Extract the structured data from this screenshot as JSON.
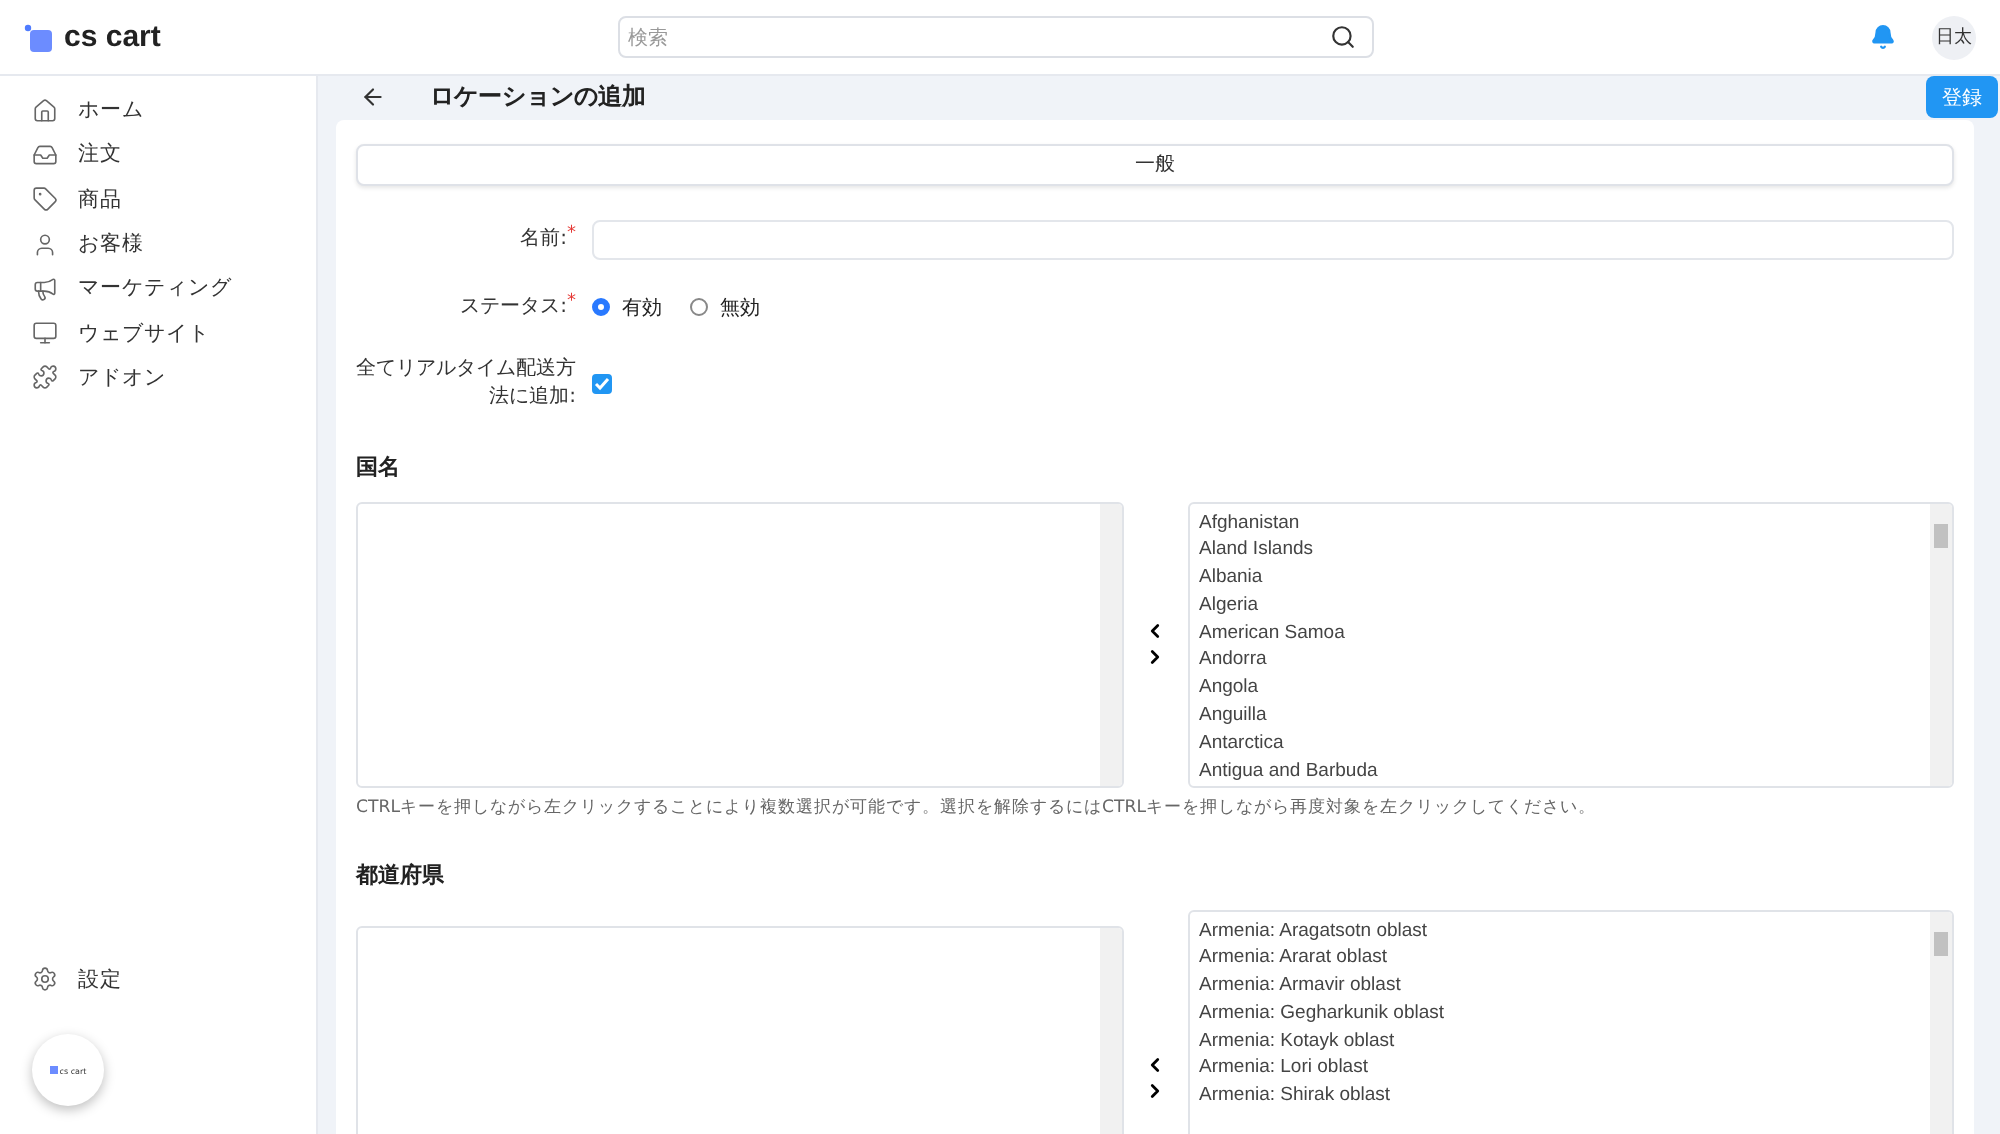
{
  "header": {
    "logo": "cs cart",
    "search": {
      "placeholder": "検索"
    },
    "user_badge": "日太"
  },
  "sidebar": {
    "items": [
      {
        "label": "ホーム"
      },
      {
        "label": "注文"
      },
      {
        "label": "商品"
      },
      {
        "label": "お客様"
      },
      {
        "label": "マーケティング"
      },
      {
        "label": "ウェブサイト"
      },
      {
        "label": "アドオン"
      }
    ],
    "settings": "設定",
    "floating_logo": "cs cart"
  },
  "page": {
    "title": "ロケーションの追加",
    "save_button": "登録"
  },
  "tabs": [
    {
      "label": "一般",
      "selected": true
    }
  ],
  "form": {
    "name_label": "名前:",
    "name_required": "*",
    "status_label": "ステータス:",
    "status_required": "*",
    "status_options": [
      {
        "label": "有効",
        "selected": true
      },
      {
        "label": "無効",
        "selected": false
      }
    ],
    "realtime_label": "全てリアルタイム配送方法に追加:",
    "realtime_checked": true
  },
  "sections": [
    {
      "title": "国名",
      "available_items": [
        "Afghanistan",
        "Aland Islands",
        "Albania",
        "Algeria",
        "American Samoa",
        "Andorra",
        "Angola",
        "Anguilla",
        "Antarctica",
        "Antigua and Barbuda"
      ],
      "hint": "CTRLキーを押しながら左クリックすることにより複数選択が可能です。選択を解除するにはCTRLキーを押しながら再度対象を左クリックしてください。"
    },
    {
      "title": "都道府県",
      "available_items": [
        "Armenia: Aragatsotn oblast",
        "Armenia: Ararat oblast",
        "Armenia: Armavir oblast",
        "Armenia: Gegharkunik oblast",
        "Armenia: Kotayk oblast",
        "Armenia: Lori oblast",
        "Armenia: Shirak oblast"
      ]
    }
  ]
}
